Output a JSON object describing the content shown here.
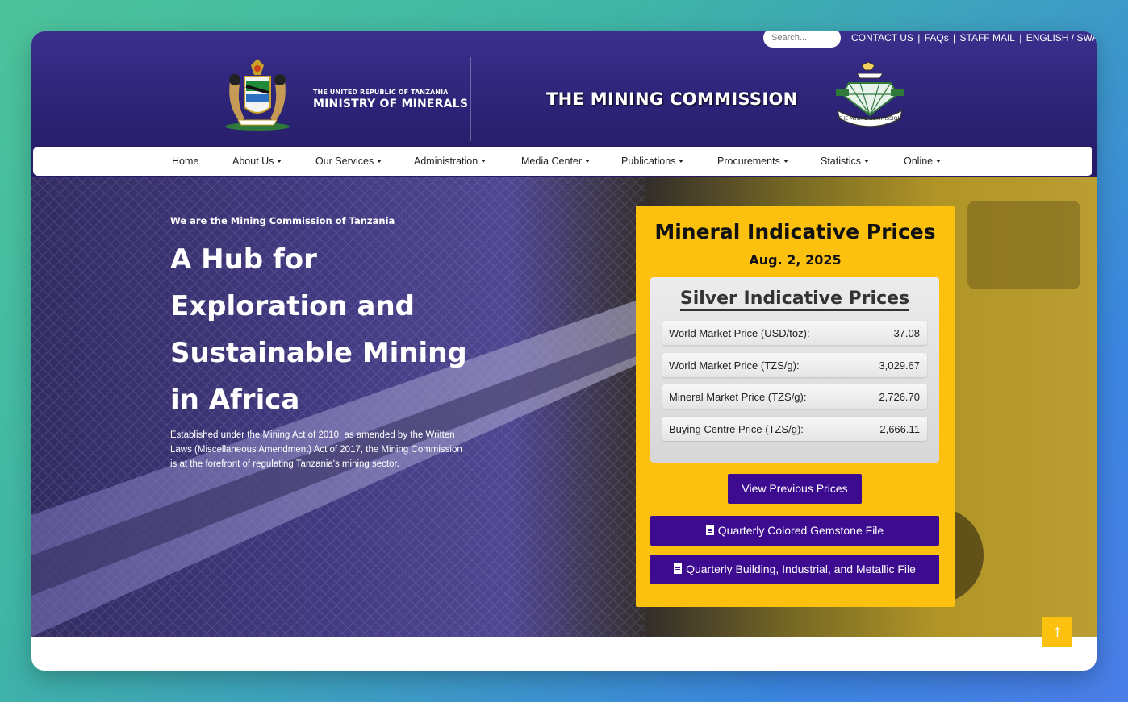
{
  "topbar": {
    "search_placeholder": "Search...",
    "links": [
      "CONTACT US",
      "FAQs",
      "STAFF MAIL",
      "ENGLISH / SWAHILI"
    ]
  },
  "header": {
    "ministry_small": "THE UNITED REPUBLIC OF TANZANIA",
    "ministry_big": "MINISTRY OF MINERALS",
    "commission_title": "THE MINING COMMISSION",
    "logo_text": "THE MINING COMMISSION"
  },
  "nav": {
    "items": [
      {
        "label": "Home"
      },
      {
        "label": "About Us"
      },
      {
        "label": "Our Services"
      },
      {
        "label": "Administration"
      },
      {
        "label": "Media Center"
      },
      {
        "label": "Publications"
      },
      {
        "label": "Procurements"
      },
      {
        "label": "Statistics"
      },
      {
        "label": "Online"
      }
    ]
  },
  "hero": {
    "kicker": "We are the Mining Commission of Tanzania",
    "title": "A Hub for Exploration and Sustainable Mining in Africa",
    "description": "Established under the Mining Act of 2010, as amended by the Written Laws (Miscellaneous Amendment) Act of 2017, the Mining Commission is at the forefront of regulating Tanzania's mining sector."
  },
  "prices": {
    "title": "Mineral Indicative Prices",
    "date": "Aug. 2, 2025",
    "silver_title": "Silver Indicative Prices",
    "rows": [
      {
        "label": "World Market Price (USD/toz):",
        "value": "37.08"
      },
      {
        "label": "World Market Price (TZS/g):",
        "value": "3,029.67"
      },
      {
        "label": "Mineral Market Price (TZS/g):",
        "value": "2,726.70"
      },
      {
        "label": "Buying Centre Price (TZS/g):",
        "value": "2,666.11"
      }
    ],
    "view_previous": "View Previous Prices",
    "file1": "Quarterly Colored Gemstone File",
    "file2": "Quarterly Building, Industrial, and Metallic File"
  },
  "colors": {
    "header": "#2c2376",
    "panel": "#fcc10f",
    "button": "#3d0b8f"
  }
}
